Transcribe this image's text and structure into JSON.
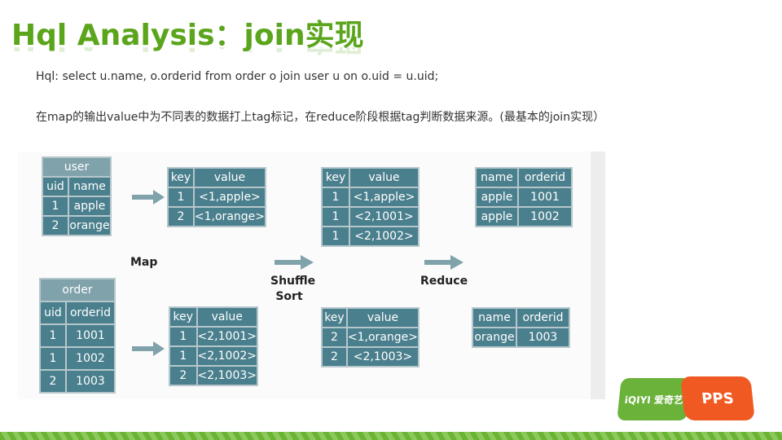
{
  "title": "Hql Analysis：join实现",
  "lines": {
    "hql": "Hql: select u.name, o.orderid from order o join user u on o.uid = u.uid;",
    "desc": "在map的输出value中为不同表的数据打上tag标记，在reduce阶段根据tag判断数据来源。(最基本的join实现）"
  },
  "tables": {
    "user": {
      "caption": "user",
      "headers": [
        "uid",
        "name"
      ],
      "rows": [
        [
          "1",
          "apple"
        ],
        [
          "2",
          "orange"
        ]
      ]
    },
    "order": {
      "caption": "order",
      "headers": [
        "uid",
        "orderid"
      ],
      "rows": [
        [
          "1",
          "1001"
        ],
        [
          "1",
          "1002"
        ],
        [
          "2",
          "1003"
        ]
      ]
    },
    "map_user": {
      "headers": [
        "key",
        "value"
      ],
      "rows": [
        [
          "1",
          "<1,apple>"
        ],
        [
          "2",
          "<1,orange>"
        ]
      ]
    },
    "map_order": {
      "headers": [
        "key",
        "value"
      ],
      "rows": [
        [
          "1",
          "<2,1001>"
        ],
        [
          "1",
          "<2,1002>"
        ],
        [
          "2",
          "<2,1003>"
        ]
      ]
    },
    "shuffle_1": {
      "headers": [
        "key",
        "value"
      ],
      "rows": [
        [
          "1",
          "<1,apple>"
        ],
        [
          "1",
          "<2,1001>"
        ],
        [
          "1",
          "<2,1002>"
        ]
      ]
    },
    "shuffle_2": {
      "headers": [
        "key",
        "value"
      ],
      "rows": [
        [
          "2",
          "<1,orange>"
        ],
        [
          "2",
          "<2,1003>"
        ]
      ]
    },
    "result_1": {
      "headers": [
        "name",
        "orderid"
      ],
      "rows": [
        [
          "apple",
          "1001"
        ],
        [
          "apple",
          "1002"
        ]
      ]
    },
    "result_2": {
      "headers": [
        "name",
        "orderid"
      ],
      "rows": [
        [
          "orange",
          "1003"
        ]
      ]
    }
  },
  "labels": {
    "map": "Map",
    "shuffle": "Shuffle",
    "sort": "Sort",
    "reduce": "Reduce"
  },
  "logos": {
    "iqiyi": "iQIYI 爱奇艺",
    "pps": "PPS"
  },
  "colors": {
    "title": "#5aa51c",
    "cell": "#4a7f8d",
    "caption": "#7fa2ab",
    "arrow": "#7fa2ab",
    "pps": "#f05a22",
    "iqiyi": "#6bb23a"
  }
}
